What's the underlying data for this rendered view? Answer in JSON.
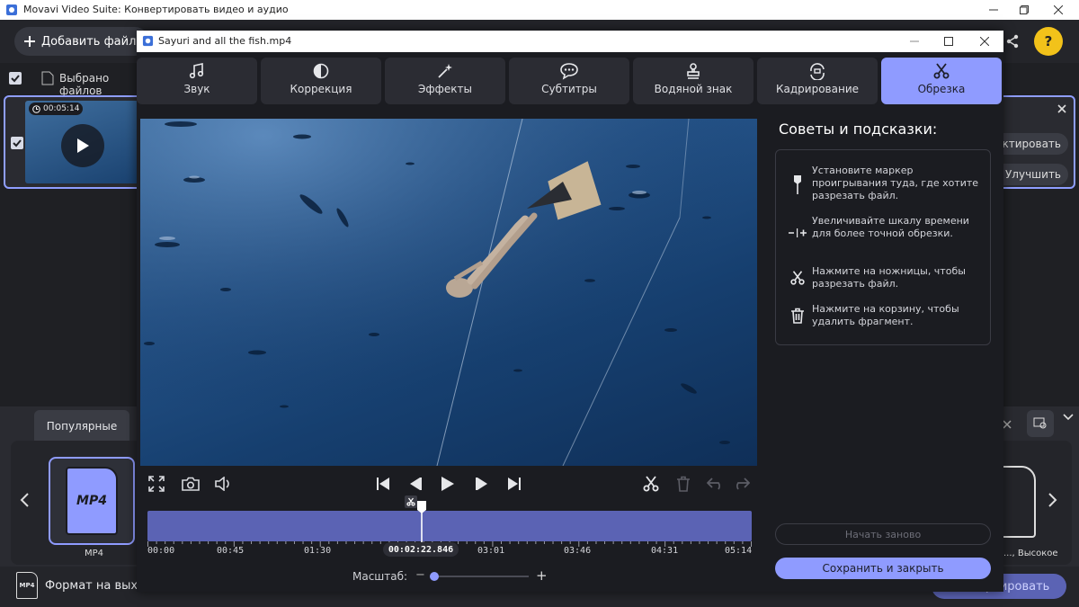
{
  "app": {
    "title": "Movavi Video Suite: Конвертировать видео и аудио"
  },
  "toolbar": {
    "add_files": "Добавить файлы"
  },
  "selection": {
    "label": "Выбрано файлов"
  },
  "file": {
    "duration": "00:05:14"
  },
  "right_panel": {
    "edit_label": "Редактировать",
    "improve_label": "Улучшить"
  },
  "bottom": {
    "tab_popular": "Популярные",
    "mp4_label": "MP4",
    "mp4_icon_text": "MP4",
    "right_format_label": "..., Высокое",
    "output_format_label": "Формат на выходе",
    "convert_label": "Конвертировать"
  },
  "dialog": {
    "title": "Sayuri and all the fish.mp4",
    "tabs": [
      {
        "label": "Звук",
        "icon": "music-note-icon"
      },
      {
        "label": "Коррекция",
        "icon": "correction-icon"
      },
      {
        "label": "Эффекты",
        "icon": "magic-wand-icon"
      },
      {
        "label": "Субтитры",
        "icon": "subtitles-icon"
      },
      {
        "label": "Водяной знак",
        "icon": "stamp-icon"
      },
      {
        "label": "Кадрирование",
        "icon": "crop-rotate-icon"
      },
      {
        "label": "Обрезка",
        "icon": "scissors-icon",
        "active": true
      }
    ],
    "timeline": {
      "labels": [
        "00:00",
        "00:45",
        "01:30",
        "03:01",
        "03:46",
        "04:31",
        "05:14"
      ],
      "current_time": "00:02:22.846",
      "playhead_fraction": 0.454
    },
    "zoom": {
      "label": "Масштаб:",
      "minus": "−",
      "plus": "+",
      "level": 0.0
    },
    "tips": {
      "heading": "Советы и подсказки:",
      "items": [
        {
          "icon": "marker-icon",
          "text": "Установите маркер проигрывания туда, где хотите разрезать файл."
        },
        {
          "icon": "zoom-scale-icon",
          "text": "Увеличивайте шкалу времени для более точной обрезки."
        },
        {
          "icon": "scissors-icon",
          "text": "Нажмите на ножницы, чтобы разрезать файл."
        },
        {
          "icon": "trash-icon",
          "text": "Нажмите на корзину, чтобы удалить фрагмент."
        }
      ]
    },
    "buttons": {
      "restart": "Начать заново",
      "save_close": "Сохранить и закрыть"
    }
  },
  "colors": {
    "accent": "#8f9bff",
    "timeline": "#5b63b4",
    "bg": "#1b1c21"
  }
}
